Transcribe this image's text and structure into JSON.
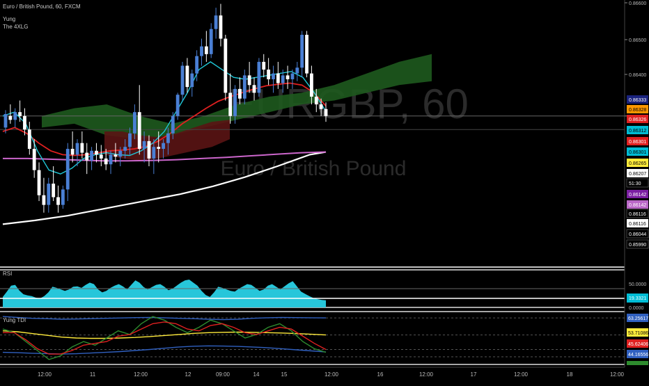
{
  "header": {
    "symbol_line": "Euro / British Pound, 60, FXCM",
    "indicator_1": "Yung",
    "indicator_2": "The 4XLG"
  },
  "watermark": {
    "symbol": "EURGBP, 60",
    "name": "Euro / British Pound"
  },
  "panes": {
    "rsi_label": "RSI",
    "tdi_label": "Yung TDI"
  },
  "colors": {
    "background": "#000000",
    "up_candle": "#4a7fd4",
    "down_candle": "#ffffff",
    "cloud_green": "#1e5a1e",
    "cloud_red": "#5a1414",
    "ma_white": "#ffffff",
    "ma_magenta": "#cc66cc",
    "ma_red": "#e02020",
    "ma_cyan": "#1fc8d8",
    "ma_olive": "#a0a040",
    "rsi_fill": "#27c6da"
  },
  "chart_data": [
    {
      "type": "candlestick",
      "title": "Euro / British Pound, 60, FXCM",
      "ylim": [
        0.8592,
        0.866
      ],
      "y_tick_labels": [
        "0.86600",
        "0.86500",
        "0.86400",
        "0.86300"
      ],
      "price_tags": [
        {
          "label": "0.86333",
          "bg": "#1a237e",
          "fg": "#ffffff"
        },
        {
          "label": "0.86328",
          "bg": "#ff9800",
          "fg": "#000000"
        },
        {
          "label": "0.86326",
          "bg": "#e02020",
          "fg": "#ffffff"
        },
        {
          "label": "0.86312",
          "bg": "#00bcd4",
          "fg": "#000000"
        },
        {
          "label": "0.86301",
          "bg": "#e02020",
          "fg": "#ffffff"
        },
        {
          "label": "0.86301",
          "bg": "#00bcd4",
          "fg": "#000000"
        },
        {
          "label": "0.86265",
          "bg": "#ffeb3b",
          "fg": "#000000"
        },
        {
          "label": "0.86207",
          "bg": "#ffffff",
          "fg": "#000000"
        },
        {
          "label": "51:30",
          "bg": "#000000",
          "fg": "#ffffff"
        },
        {
          "label": "0.86142",
          "bg": "#7b1fa2",
          "fg": "#ffffff"
        },
        {
          "label": "0.86142",
          "bg": "#ba68c8",
          "fg": "#ffffff"
        },
        {
          "label": "0.86116",
          "bg": "#000000",
          "fg": "#ffffff"
        },
        {
          "label": "0.86116",
          "bg": "#ffffff",
          "fg": "#000000"
        },
        {
          "label": "0.86044",
          "bg": "#000000",
          "fg": "#ffffff"
        },
        {
          "label": "0.85990",
          "bg": "#000000",
          "fg": "#ffffff"
        }
      ],
      "current_price": 0.863,
      "x_tick_labels": [
        "12:00",
        "11",
        "12:00",
        "12",
        "09:00",
        "14",
        "15",
        "12:00",
        "16",
        "12:00",
        "17",
        "12:00",
        "18",
        "12:00"
      ],
      "series": [
        {
          "name": "",
          "type": "ohlc",
          "values": [
            [
              0.8627,
              0.86315,
              0.86255,
              0.86305
            ],
            [
              0.863,
              0.8633,
              0.8628,
              0.8629
            ],
            [
              0.8629,
              0.8632,
              0.8627,
              0.8631
            ],
            [
              0.8631,
              0.8634,
              0.86285,
              0.863
            ],
            [
              0.863,
              0.8632,
              0.8625,
              0.86265
            ],
            [
              0.86265,
              0.86285,
              0.862,
              0.86215
            ],
            [
              0.86215,
              0.8624,
              0.8614,
              0.8616
            ],
            [
              0.8616,
              0.8618,
              0.8608,
              0.86095
            ],
            [
              0.86095,
              0.8614,
              0.8605,
              0.8607
            ],
            [
              0.8607,
              0.8614,
              0.8605,
              0.86125
            ],
            [
              0.86125,
              0.8617,
              0.8608,
              0.8609
            ],
            [
              0.8609,
              0.8612,
              0.8605,
              0.8607
            ],
            [
              0.8607,
              0.8612,
              0.8606,
              0.8611
            ],
            [
              0.8611,
              0.8623,
              0.8608,
              0.86215
            ],
            [
              0.86215,
              0.8626,
              0.8618,
              0.862
            ],
            [
              0.862,
              0.8624,
              0.8617,
              0.8623
            ],
            [
              0.8623,
              0.8626,
              0.8619,
              0.86205
            ],
            [
              0.86205,
              0.8623,
              0.8615,
              0.86185
            ],
            [
              0.86185,
              0.8622,
              0.8616,
              0.8621
            ],
            [
              0.8621,
              0.8623,
              0.8618,
              0.862
            ],
            [
              0.862,
              0.86225,
              0.8617,
              0.8619
            ],
            [
              0.8619,
              0.86215,
              0.8616,
              0.86175
            ],
            [
              0.86175,
              0.8621,
              0.8615,
              0.862
            ],
            [
              0.862,
              0.8623,
              0.8618,
              0.86195
            ],
            [
              0.86195,
              0.8622,
              0.8617,
              0.8621
            ],
            [
              0.8621,
              0.8624,
              0.8619,
              0.8622
            ],
            [
              0.8622,
              0.8627,
              0.862,
              0.86255
            ],
            [
              0.86255,
              0.8633,
              0.8624,
              0.8631
            ],
            [
              0.8631,
              0.8638,
              0.862,
              0.86215
            ],
            [
              0.86215,
              0.8626,
              0.8618,
              0.86235
            ],
            [
              0.86235,
              0.8625,
              0.8617,
              0.8619
            ],
            [
              0.8619,
              0.8624,
              0.8615,
              0.8622
            ],
            [
              0.8622,
              0.8626,
              0.8618,
              0.86215
            ],
            [
              0.86215,
              0.8624,
              0.8619,
              0.8623
            ],
            [
              0.8623,
              0.8627,
              0.862,
              0.86255
            ],
            [
              0.86255,
              0.8631,
              0.8624,
              0.863
            ],
            [
              0.863,
              0.8636,
              0.8629,
              0.86355
            ],
            [
              0.86355,
              0.8644,
              0.8634,
              0.8643
            ],
            [
              0.8643,
              0.8645,
              0.8636,
              0.86375
            ],
            [
              0.86375,
              0.8642,
              0.8635,
              0.8641
            ],
            [
              0.8641,
              0.8647,
              0.8639,
              0.86455
            ],
            [
              0.86455,
              0.865,
              0.8643,
              0.8648
            ],
            [
              0.8648,
              0.8652,
              0.8644,
              0.8646
            ],
            [
              0.8646,
              0.8654,
              0.8645,
              0.86525
            ],
            [
              0.86525,
              0.8658,
              0.865,
              0.8656
            ],
            [
              0.8656,
              0.8659,
              0.8648,
              0.865
            ],
            [
              0.865,
              0.8651,
              0.8634,
              0.8636
            ],
            [
              0.8636,
              0.8641,
              0.8628,
              0.863
            ],
            [
              0.863,
              0.8638,
              0.8628,
              0.8637
            ],
            [
              0.8637,
              0.864,
              0.8633,
              0.86345
            ],
            [
              0.86345,
              0.8642,
              0.8633,
              0.86405
            ],
            [
              0.86405,
              0.8644,
              0.8636,
              0.8638
            ],
            [
              0.8638,
              0.864,
              0.8634,
              0.8636
            ],
            [
              0.8636,
              0.8645,
              0.8635,
              0.8644
            ],
            [
              0.8644,
              0.8646,
              0.864,
              0.8642
            ],
            [
              0.8642,
              0.8645,
              0.8638,
              0.86395
            ],
            [
              0.86395,
              0.8643,
              0.8636,
              0.8641
            ],
            [
              0.8641,
              0.8644,
              0.8637,
              0.86385
            ],
            [
              0.86385,
              0.8642,
              0.8636,
              0.86405
            ],
            [
              0.86405,
              0.8643,
              0.8637,
              0.86395
            ],
            [
              0.86395,
              0.8642,
              0.8637,
              0.8641
            ],
            [
              0.8641,
              0.8644,
              0.8639,
              0.86425
            ],
            [
              0.86425,
              0.8652,
              0.864,
              0.8651
            ],
            [
              0.8651,
              0.8652,
              0.864,
              0.8641
            ],
            [
              0.8641,
              0.8643,
              0.8633,
              0.8635
            ],
            [
              0.8635,
              0.8637,
              0.8631,
              0.8633
            ],
            [
              0.8633,
              0.86345,
              0.863,
              0.86318
            ],
            [
              0.86318,
              0.86335,
              0.86285,
              0.863
            ]
          ]
        },
        {
          "name": "",
          "type": "line",
          "color": "#ffffff",
          "values": [
            0.8602,
            0.86025,
            0.8603,
            0.86036,
            0.86042,
            0.8605,
            0.86058,
            0.86066,
            0.86074,
            0.86082,
            0.8609,
            0.86098,
            0.86108,
            0.86118,
            0.8613,
            0.86142,
            0.86156,
            0.8617,
            0.86185,
            0.862,
            0.86207
          ]
        },
        {
          "name": "",
          "type": "line",
          "color": "#cc66cc",
          "values": [
            0.8619,
            0.8619,
            0.86188,
            0.86186,
            0.86184,
            0.86184,
            0.86185,
            0.86187,
            0.8619,
            0.86193,
            0.86197,
            0.86201,
            0.86205,
            0.86207
          ]
        },
        {
          "name": "",
          "type": "line",
          "color": "#e02020",
          "values": [
            0.8626,
            0.8627,
            0.86255,
            0.8623,
            0.8621,
            0.862,
            0.86198,
            0.862,
            0.86205,
            0.8621,
            0.86212,
            0.86215,
            0.86222,
            0.86235,
            0.86255,
            0.8628,
            0.863,
            0.8632,
            0.86338,
            0.8635,
            0.8636,
            0.8637,
            0.86378,
            0.86382,
            0.86385,
            0.8638,
            0.8636,
            0.86326
          ]
        },
        {
          "name": "",
          "type": "line",
          "color": "#1fc8d8",
          "values": [
            0.863,
            0.8631,
            0.8628,
            0.8621,
            0.8616,
            0.8615,
            0.86165,
            0.8619,
            0.862,
            0.86205,
            0.862,
            0.86198,
            0.8621,
            0.8623,
            0.8626,
            0.8631,
            0.8636,
            0.8642,
            0.8644,
            0.8642,
            0.864,
            0.86395,
            0.864,
            0.86405,
            0.8641,
            0.86415,
            0.864,
            0.8636,
            0.86312
          ]
        },
        {
          "name": "",
          "type": "area",
          "color": "#1e5a1e",
          "values": [
            [
              0.8627,
              0.863
            ],
            [
              0.8628,
              0.8632
            ],
            [
              0.8625,
              0.8633
            ],
            [
              0.8624,
              0.863
            ],
            [
              0.8625,
              0.8628
            ],
            [
              0.8627,
              0.863
            ],
            [
              0.8629,
              0.8633
            ],
            [
              0.8631,
              0.8635
            ],
            [
              0.8633,
              0.8636
            ],
            [
              0.8634,
              0.8638
            ],
            [
              0.8636,
              0.8641
            ],
            [
              0.8638,
              0.8644
            ],
            [
              0.8639,
              0.8646
            ]
          ]
        },
        {
          "name": "",
          "type": "area",
          "color": "#5a1414",
          "values": [
            [
              0.862,
              0.8626
            ],
            [
              0.8619,
              0.8626
            ],
            [
              0.86185,
              0.8625
            ],
            [
              0.8619,
              0.86245
            ],
            [
              0.862,
              0.86255
            ],
            [
              0.8621,
              0.8627
            ],
            [
              0.8622,
              0.86285
            ],
            [
              0.8624,
              0.8629
            ]
          ]
        }
      ]
    },
    {
      "type": "area",
      "title": "RSI",
      "ylim": [
        0,
        100
      ],
      "y_tick_labels": [
        "50.0000",
        "0.0000"
      ],
      "last_value_label": "19.3321",
      "series": [
        {
          "name": "",
          "values": [
            28,
            42,
            58,
            60,
            45,
            35,
            32,
            30,
            26,
            24,
            30,
            40,
            55,
            52,
            48,
            44,
            48,
            55,
            56,
            52,
            60,
            66,
            62,
            48,
            40,
            44,
            52,
            58,
            62,
            56,
            48,
            60,
            72,
            66,
            54,
            48,
            54,
            60,
            62,
            55,
            46,
            50,
            58,
            66,
            72,
            74,
            66,
            58,
            44,
            33,
            28,
            40,
            55,
            52,
            48,
            44,
            42,
            50,
            56,
            62,
            60,
            52,
            44,
            48,
            58,
            62,
            55,
            48,
            56,
            64,
            70,
            56,
            42,
            36,
            30,
            25,
            22,
            20,
            19
          ]
        }
      ]
    },
    {
      "type": "line",
      "title": "Yung TDI",
      "ylim": [
        38,
        66
      ],
      "y_tick_labels": [
        "63.25617",
        "53.71086",
        "45.62406",
        "44.16556"
      ],
      "series": [
        {
          "name": "",
          "color": "#3060c0",
          "values": [
            64,
            63.5,
            63,
            62.8,
            62.5,
            62.6,
            62.8,
            63,
            63.2,
            63.4,
            63.5,
            63.3,
            63,
            62.8,
            62.5,
            62.3,
            62.5,
            63,
            63.3,
            63.5,
            63.4,
            63.3,
            63.25
          ]
        },
        {
          "name": "",
          "color": "#3060c0",
          "values": [
            44,
            43.8,
            43.5,
            43.3,
            43,
            43.2,
            43.6,
            44,
            44.4,
            45,
            45.6,
            46.3,
            47,
            47.4,
            47.6,
            47.5,
            47.3,
            47,
            46.6,
            46,
            45.4,
            44.8,
            44.17
          ]
        },
        {
          "name": "",
          "color": "#ffeb3b",
          "values": [
            56,
            55.5,
            54.5,
            53.5,
            52.5,
            52,
            51.8,
            51.8,
            52,
            52.3,
            52.8,
            53.4,
            54,
            54.6,
            55,
            55.2,
            55.3,
            55.2,
            55,
            54.8,
            54.5,
            54.1,
            53.71
          ]
        },
        {
          "name": "",
          "color": "#2e8b2e",
          "values": [
            57,
            55,
            50,
            45,
            40,
            42,
            47,
            50,
            48,
            52,
            56,
            54,
            60,
            64,
            62,
            58,
            55,
            58,
            62,
            60,
            56,
            52,
            54,
            58,
            60,
            56,
            50,
            46,
            44
          ]
        },
        {
          "name": "",
          "color": "#e02020",
          "values": [
            55,
            55,
            51,
            46,
            43,
            43,
            45,
            48,
            49,
            50,
            53,
            54,
            57,
            60,
            61,
            60,
            57,
            56,
            59,
            60,
            58,
            55,
            54,
            56,
            58,
            57,
            53,
            49,
            45.6
          ]
        }
      ]
    }
  ]
}
